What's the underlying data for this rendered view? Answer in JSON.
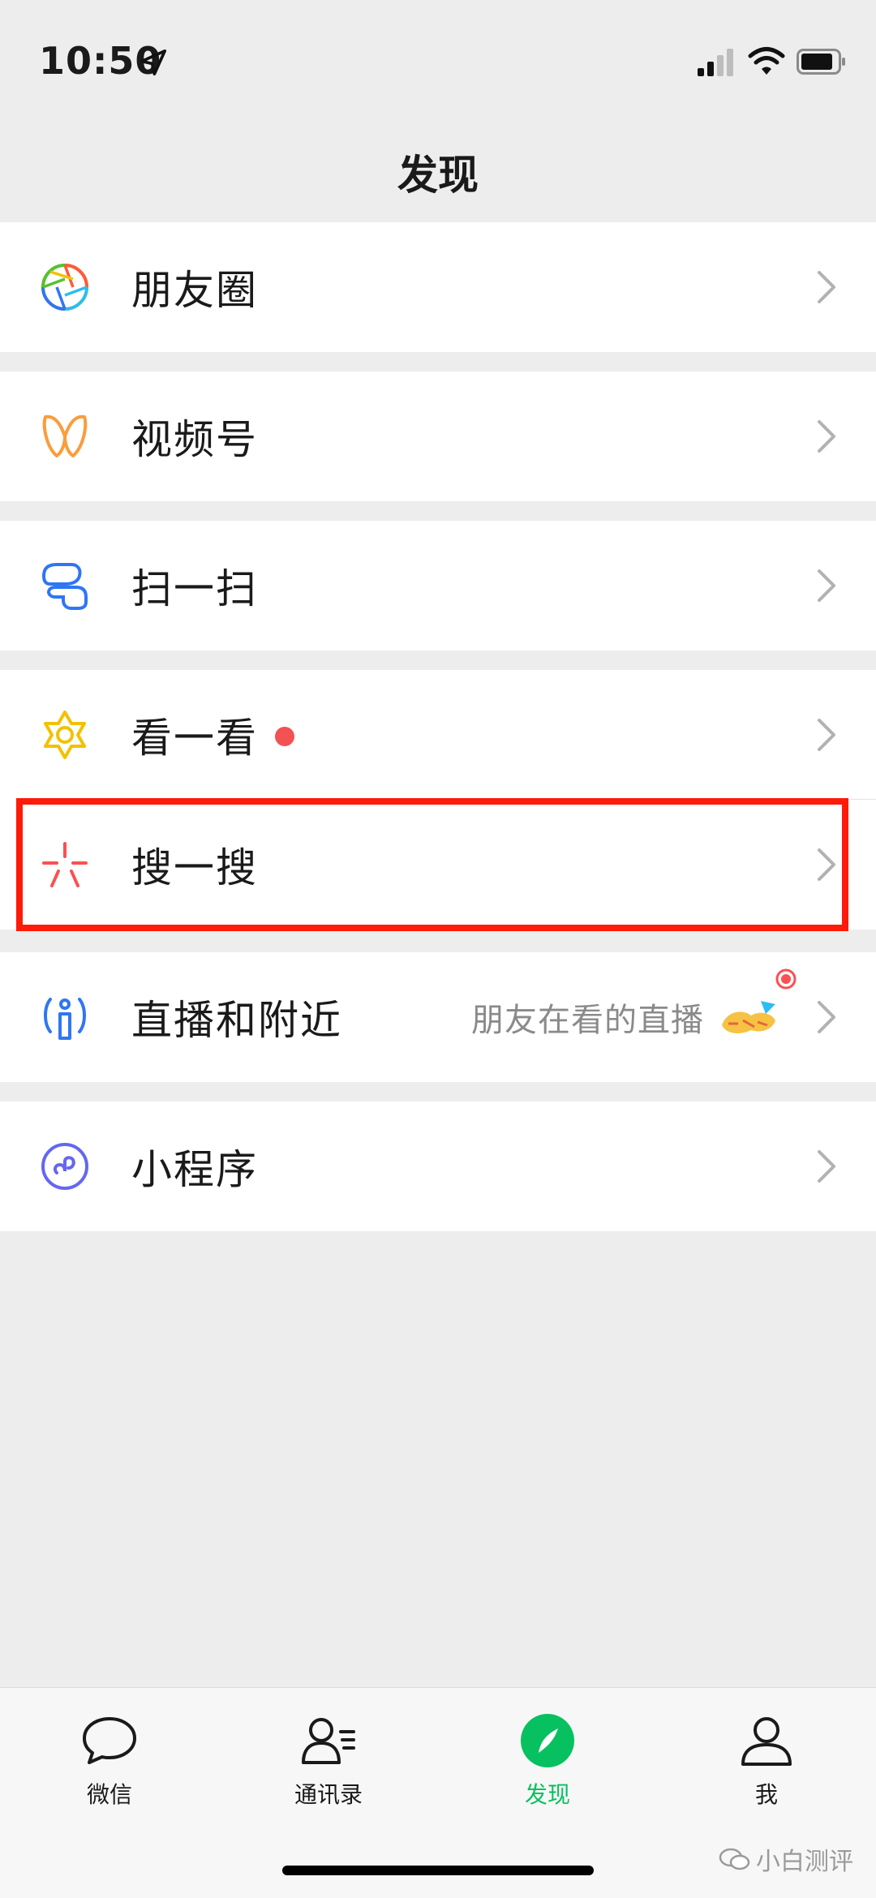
{
  "status_bar": {
    "time": "10:50"
  },
  "nav": {
    "title": "发现"
  },
  "cells": {
    "moments": "朋友圈",
    "channels": "视频号",
    "scan": "扫一扫",
    "top_stories": "看一看",
    "search": "搜一搜",
    "live_nearby": "直播和附近",
    "live_nearby_subtitle": "朋友在看的直播",
    "mini_programs": "小程序"
  },
  "tabs": [
    {
      "label": "微信",
      "icon": "chat-bubble-icon",
      "active": false
    },
    {
      "label": "通讯录",
      "icon": "contacts-icon",
      "active": false
    },
    {
      "label": "发现",
      "icon": "compass-icon",
      "active": true
    },
    {
      "label": "我",
      "icon": "person-icon",
      "active": false
    }
  ],
  "watermark": {
    "text": "小白测评"
  },
  "colors": {
    "accent": "#07c160",
    "highlight": "#ff1a0a",
    "badge_red": "#f35252"
  }
}
